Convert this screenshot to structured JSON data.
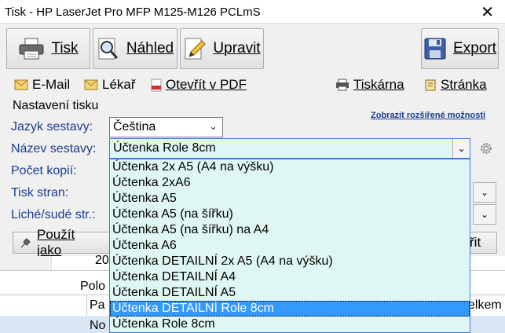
{
  "window": {
    "title": "Tisk - HP LaserJet Pro MFP M125-M126 PCLmS",
    "close_glyph": "✕"
  },
  "toolbar": {
    "print": "Tisk",
    "preview": "Náhled",
    "edit": "Upravit",
    "export": "Export"
  },
  "links": {
    "email": "E-Mail",
    "doctor": "Lékař",
    "open_pdf": "Otevřít v PDF",
    "printer": "Tiskárna",
    "page": "Stránka"
  },
  "settings": {
    "group_title": "Nastavení tisku",
    "advanced_link": "Zobrazit rozšířené možnosti",
    "language_label": "Jazyk sestavy:",
    "language_value": "Čeština",
    "report_label": "Název sestavy:",
    "report_value": "Účtenka Role 8cm",
    "copies_label": "Počet kopií:",
    "pages_label": "Tisk stran:",
    "oddeven_label": "Liché/sudé str.:"
  },
  "dropdown": {
    "items": [
      "Účtenka 2x A5 (A4 na výšku)",
      "Účtenka 2xA6",
      "Účtenka A5",
      "Účtenka A5 (na šířku)",
      "Účtenka A5 (na šířku) na A4",
      "Účtenka A6",
      "Účtenka DETAILNÍ 2x A5 (A4 na výšku)",
      "Účtenka DETAILNÍ A4",
      "Účtenka DETAILNÍ A5",
      "Účtenka DETAILNÍ Role 8cm",
      "Účtenka Role 8cm"
    ],
    "selected_index": 9
  },
  "buttons": {
    "use_as": "Použít jako",
    "right_partial": "řit"
  },
  "background": {
    "num_partial": "20",
    "col_partial": "Polo",
    "col2_partial": "Pa",
    "col3_partial": "elkem",
    "row_partial": "No"
  },
  "colors": {
    "label": "#1a3e8c",
    "dropdown_bg": "#dff7f2",
    "selection": "#3399ff"
  }
}
